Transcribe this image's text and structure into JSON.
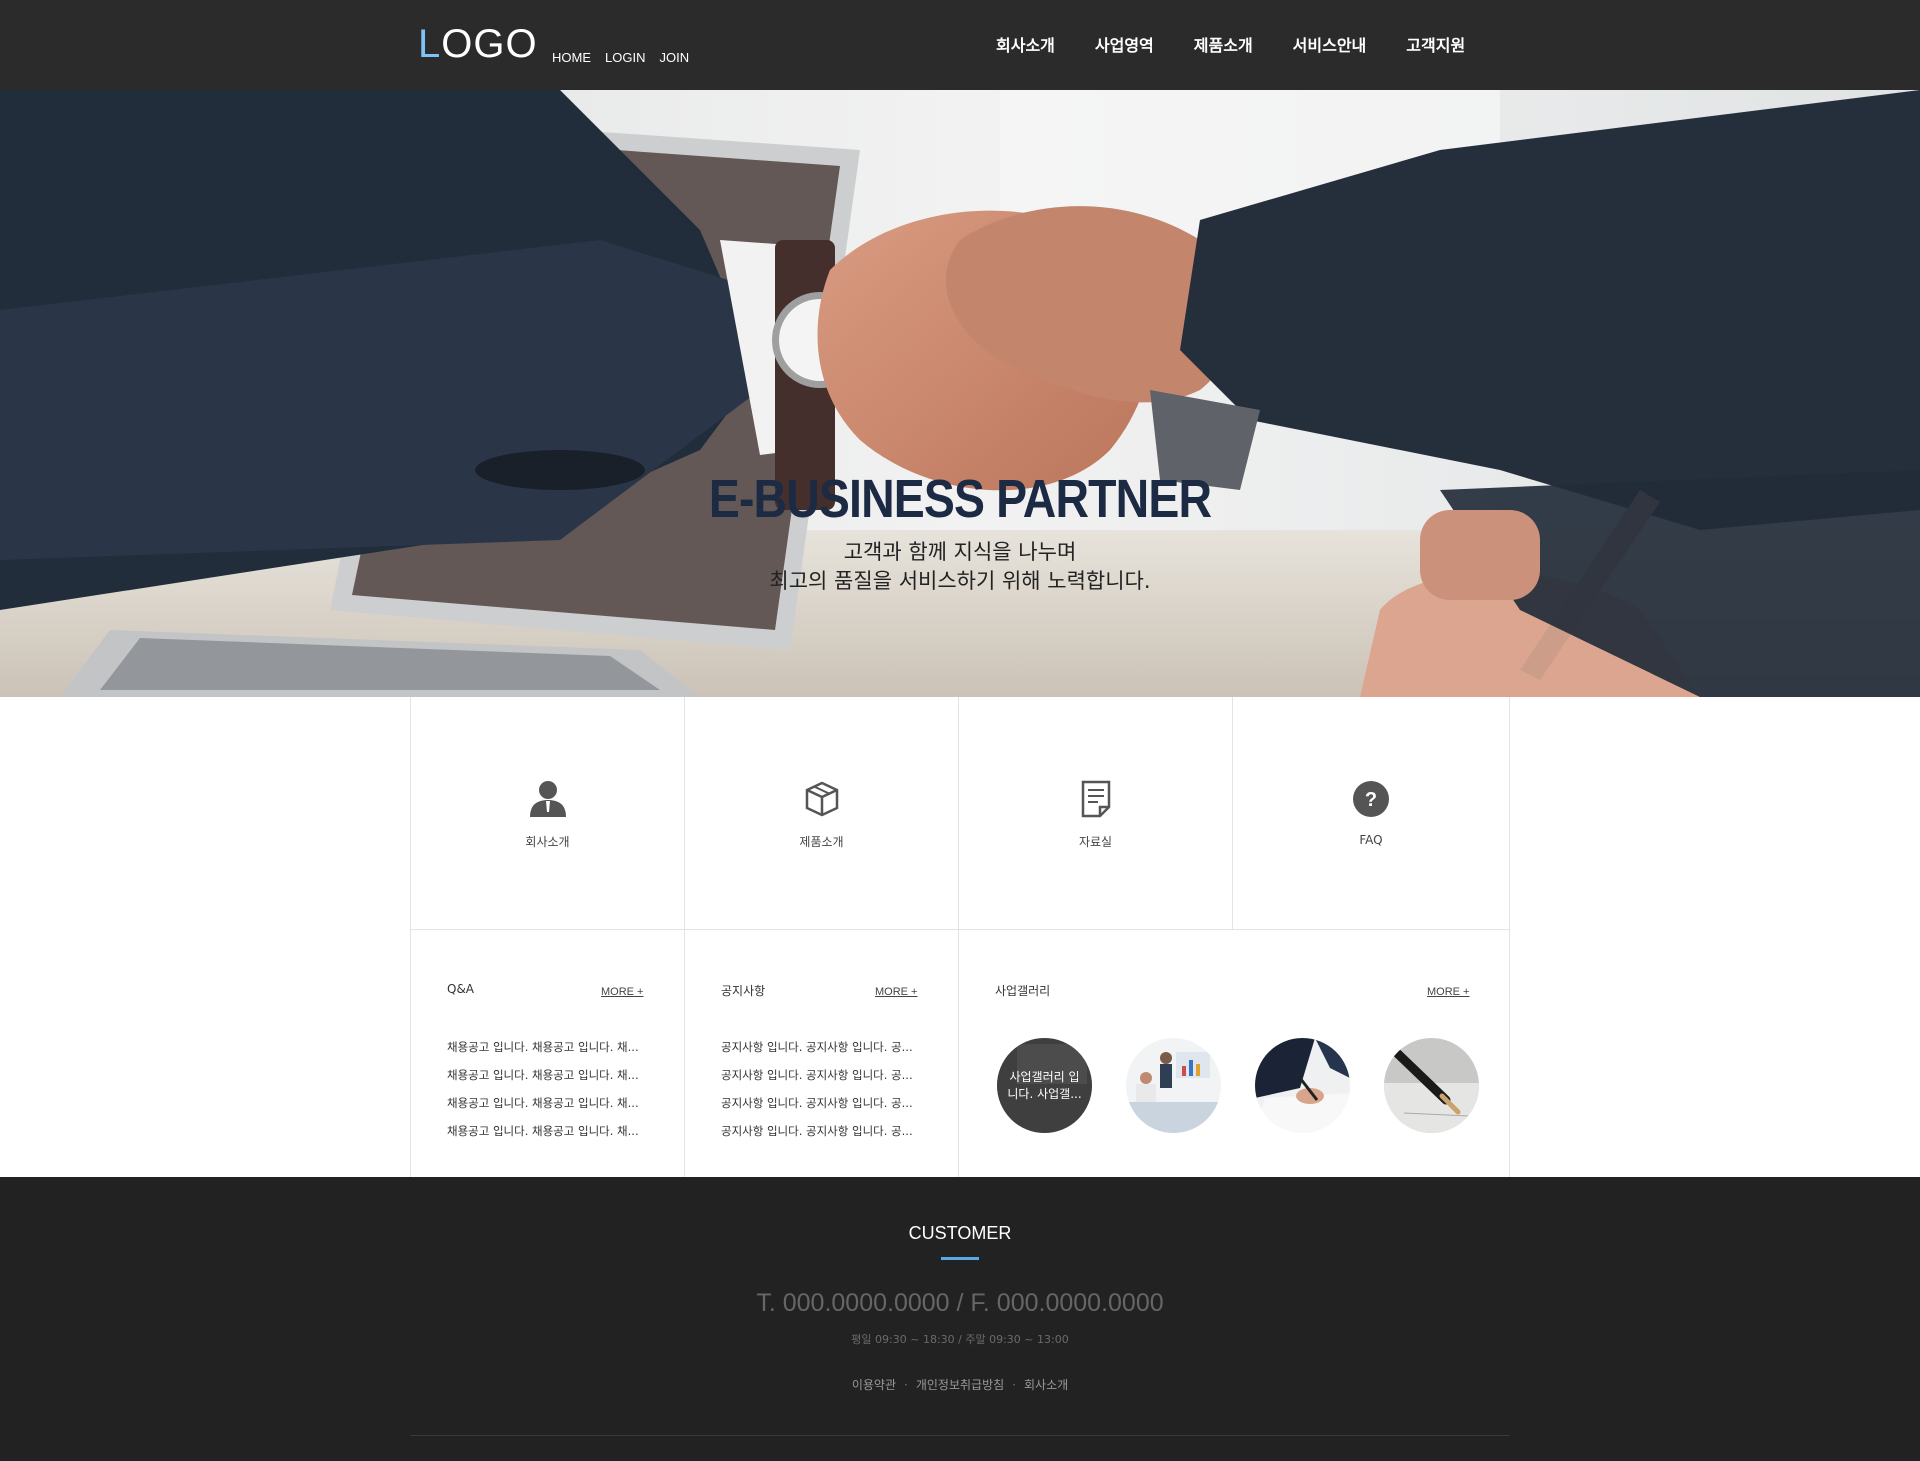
{
  "header": {
    "logo_first": "L",
    "logo_rest": "OGO",
    "util": [
      "HOME",
      "LOGIN",
      "JOIN"
    ],
    "nav": [
      "회사소개",
      "사업영역",
      "제품소개",
      "서비스안내",
      "고객지원"
    ]
  },
  "hero": {
    "title": "E-BUSINESS PARTNER",
    "line1": "고객과 함께 지식을 나누며",
    "line2": "최고의 품질을 서비스하기 위해 노력합니다."
  },
  "quick": [
    {
      "label": "회사소개",
      "icon": "person-icon"
    },
    {
      "label": "제품소개",
      "icon": "box-icon"
    },
    {
      "label": "자료실",
      "icon": "document-icon"
    },
    {
      "label": "FAQ",
      "icon": "question-icon"
    }
  ],
  "qna": {
    "title": "Q&A",
    "more": "MORE +",
    "items": [
      "채용공고 입니다. 채용공고 입니다. 채...",
      "채용공고 입니다. 채용공고 입니다. 채...",
      "채용공고 입니다. 채용공고 입니다. 채...",
      "채용공고 입니다. 채용공고 입니다. 채..."
    ]
  },
  "notice": {
    "title": "공지사항",
    "more": "MORE +",
    "items": [
      "공지사항 입니다. 공지사항 입니다. 공...",
      "공지사항 입니다. 공지사항 입니다. 공...",
      "공지사항 입니다. 공지사항 입니다. 공...",
      "공지사항 입니다. 공지사항 입니다. 공..."
    ]
  },
  "gallery": {
    "title": "사업갤러리",
    "more": "MORE +",
    "caption": "사업갤러리 입니다. 사업갤..."
  },
  "footer": {
    "title": "CUSTOMER",
    "tel": "T. 000.0000.0000 / F. 000.0000.0000",
    "hours": "평일 09:30 ~ 18:30 / 주말 09:30 ~ 13:00",
    "links": [
      "이용약관",
      "개인정보취급방침",
      "회사소개"
    ],
    "accent": "#5aa9e6"
  }
}
